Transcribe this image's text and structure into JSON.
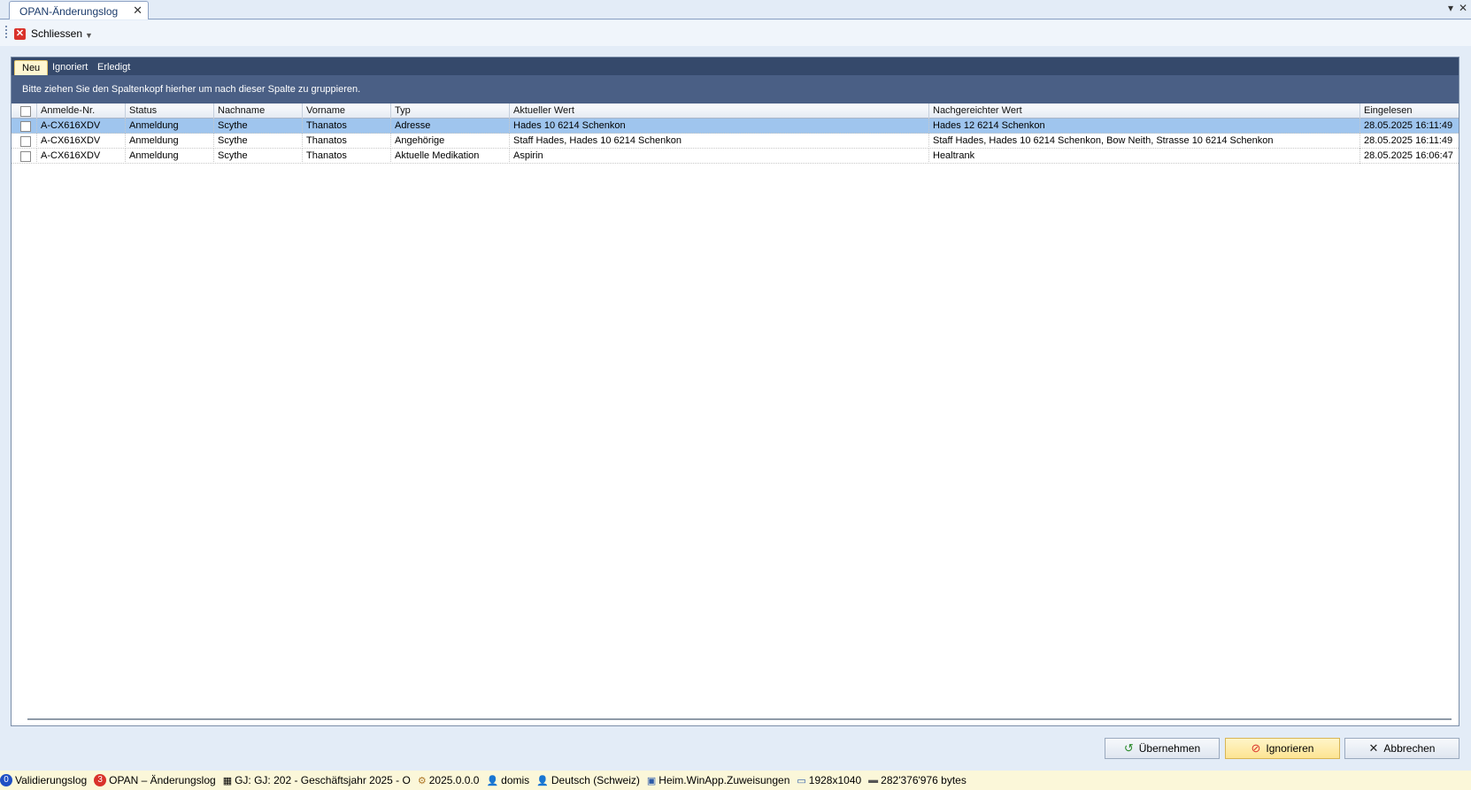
{
  "document_tab": {
    "title": "OPAN-Änderungslog"
  },
  "window_buttons": {
    "dropdown": "▾",
    "close": "✕"
  },
  "toolbar": {
    "close_label": "Schliessen"
  },
  "panel_tabs": [
    {
      "label": "Neu",
      "active": true
    },
    {
      "label": "Ignoriert",
      "active": false
    },
    {
      "label": "Erledigt",
      "active": false
    }
  ],
  "group_hint": "Bitte ziehen Sie den Spaltenkopf hierher um nach dieser Spalte zu gruppieren.",
  "grid": {
    "columns": [
      "Anmelde-Nr.",
      "Status",
      "Nachname",
      "Vorname",
      "Typ",
      "Aktueller Wert",
      "Nachgereichter Wert",
      "Eingelesen"
    ],
    "rows": [
      {
        "selected": true,
        "cells": [
          "A-CX616XDV",
          "Anmeldung",
          "Scythe",
          "Thanatos",
          "Adresse",
          "Hades 10 6214 Schenkon",
          "Hades 12 6214 Schenkon",
          "28.05.2025 16:11:49"
        ]
      },
      {
        "selected": false,
        "cells": [
          "A-CX616XDV",
          "Anmeldung",
          "Scythe",
          "Thanatos",
          "Angehörige",
          "Staff Hades, Hades 10 6214 Schenkon",
          "Staff Hades, Hades 10 6214 Schenkon, Bow Neith, Strasse 10 6214 Schenkon",
          "28.05.2025 16:11:49"
        ]
      },
      {
        "selected": false,
        "cells": [
          "A-CX616XDV",
          "Anmeldung",
          "Scythe",
          "Thanatos",
          "Aktuelle Medikation",
          "Aspirin",
          "Healtrank",
          "28.05.2025 16:06:47"
        ]
      }
    ]
  },
  "buttons": {
    "uebernehmen": "Übernehmen",
    "ignorieren": "Ignorieren",
    "abbrechen": "Abbrechen"
  },
  "statusbar": {
    "validierungslog_count": "0",
    "validierungslog": "Validierungslog",
    "opan_count": "3",
    "opan": "OPAN – Änderungslog",
    "geschaeftsjahr": "GJ: GJ: 202 - Geschäftsjahr 2025 - O",
    "version": "2025.0.0.0",
    "user": "domis",
    "language": "Deutsch (Schweiz)",
    "module": "Heim.WinApp.Zuweisungen",
    "resolution": "1928x1040",
    "memory": "282'376'976 bytes"
  },
  "colors": {
    "selected_row": "#9fc5ee",
    "panel_header": "#35496b",
    "statusbar": "#fbf7d9"
  }
}
